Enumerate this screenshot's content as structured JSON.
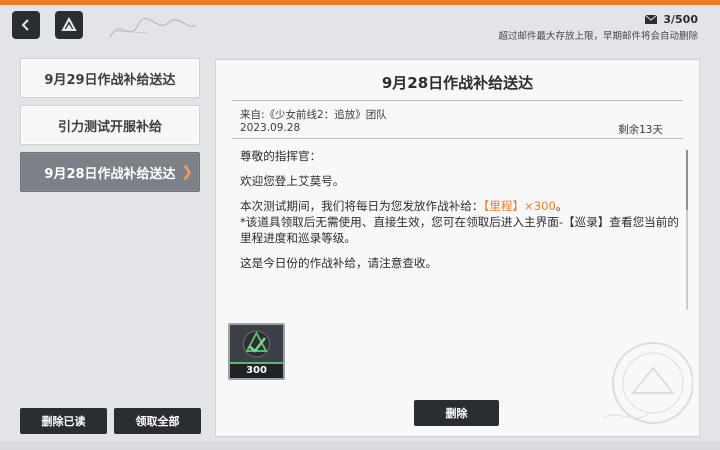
{
  "header": {
    "mail_count": "3/500",
    "mail_note": "超过邮件最大存放上限，早期邮件将会自动删除"
  },
  "mail_list": {
    "items": [
      {
        "tag": "",
        "title": "9月29日作战补给送达",
        "active": false
      },
      {
        "tag": "",
        "title": "引力测试开服补给",
        "active": false
      },
      {
        "tag": "",
        "title": "9月28日作战补给送达",
        "active": true
      }
    ]
  },
  "buttons": {
    "delete_read": "删除已读",
    "claim_all": "领取全部",
    "delete": "删除"
  },
  "mail": {
    "title": "9月28日作战补给送达",
    "from": "来自:《少女前线2：追放》团队",
    "date": "2023.09.28",
    "remaining": "剩余13天",
    "greeting": "尊敬的指挥官：",
    "welcome": "欢迎您登上艾莫号。",
    "body_prefix": "本次测试期间，我们将每日为您发放作战补给：",
    "body_highlight": "【里程】×300",
    "body_suffix": "。",
    "note": "*该道具领取后无需使用、直接生效，您可在领取后进入主界面-【巡录】查看您当前的里程进度和巡录等级。",
    "closing": "这是今日份的作战补给，请注意查收。"
  },
  "reward": {
    "quantity": "300",
    "icon": "mileage-icon"
  },
  "colors": {
    "accent": "#f07a2a",
    "dark_button": "#2a2d32",
    "active_item": "#7d8086"
  }
}
